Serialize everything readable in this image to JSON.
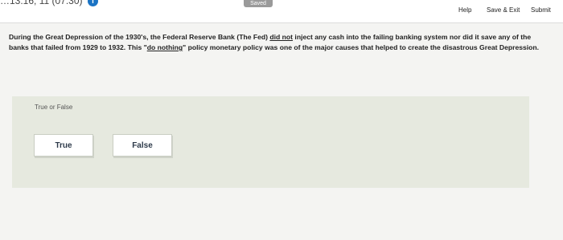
{
  "topbar": {
    "timer": "…13:16, 11 (07:30)",
    "info": "i",
    "saved_label": "Saved",
    "help_label": "Help",
    "save_exit_label": "Save & Exit",
    "submit_label": "Submit"
  },
  "question": {
    "part1": "During the Great Depression of the 1930's, the Federal Reserve Bank (The Fed) ",
    "underline1": "did not",
    "part2": " inject any cash into the failing banking system nor did it save any of the banks that failed from 1929 to 1932. This \"",
    "underline2": "do nothing",
    "part3": "\" policy monetary policy was one of the major causes that helped to create the disastrous Great Depression."
  },
  "answer": {
    "prompt": "True or False",
    "options": [
      "True",
      "False"
    ]
  }
}
